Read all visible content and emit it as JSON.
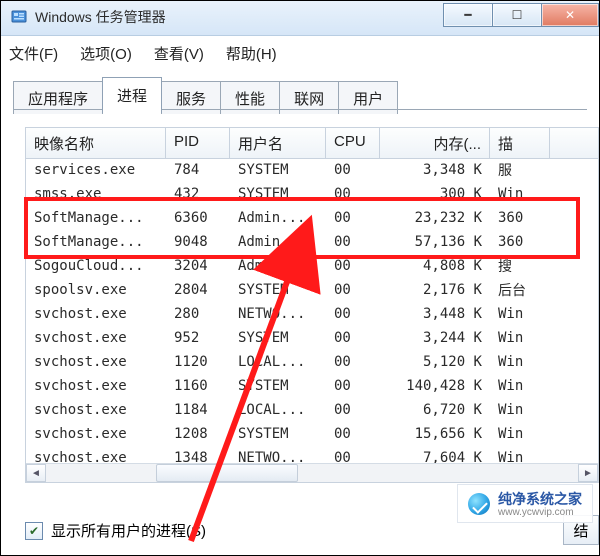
{
  "titlebar": {
    "title": "Windows 任务管理器"
  },
  "menu": {
    "file": "文件(F)",
    "options": "选项(O)",
    "view": "查看(V)",
    "help": "帮助(H)"
  },
  "tabs": {
    "apps": "应用程序",
    "processes": "进程",
    "services": "服务",
    "performance": "性能",
    "network": "联网",
    "users": "用户"
  },
  "columns": {
    "image": "映像名称",
    "pid": "PID",
    "user": "用户名",
    "cpu": "CPU",
    "mem": "内存(...",
    "desc": "描"
  },
  "rows": [
    {
      "n": "services.exe",
      "p": "784",
      "u": "SYSTEM",
      "c": "00",
      "m": "3,348 K",
      "d": "服"
    },
    {
      "n": "smss.exe",
      "p": "432",
      "u": "SYSTEM",
      "c": "00",
      "m": "300 K",
      "d": "Win"
    },
    {
      "n": "SoftManage...",
      "p": "6360",
      "u": "Admin...",
      "c": "00",
      "m": "23,232 K",
      "d": "360"
    },
    {
      "n": "SoftManage...",
      "p": "9048",
      "u": "Admin...",
      "c": "00",
      "m": "57,136 K",
      "d": "360"
    },
    {
      "n": "SogouCloud...",
      "p": "3204",
      "u": "Admin...",
      "c": "00",
      "m": "4,808 K",
      "d": "搜"
    },
    {
      "n": "spoolsv.exe",
      "p": "2804",
      "u": "SYSTEM",
      "c": "00",
      "m": "2,176 K",
      "d": "后台"
    },
    {
      "n": "svchost.exe",
      "p": "280",
      "u": "NETWO...",
      "c": "00",
      "m": "3,448 K",
      "d": "Win"
    },
    {
      "n": "svchost.exe",
      "p": "952",
      "u": "SYSTEM",
      "c": "00",
      "m": "3,244 K",
      "d": "Win"
    },
    {
      "n": "svchost.exe",
      "p": "1120",
      "u": "LOCAL...",
      "c": "00",
      "m": "5,120 K",
      "d": "Win"
    },
    {
      "n": "svchost.exe",
      "p": "1160",
      "u": "SYSTEM",
      "c": "00",
      "m": "140,428 K",
      "d": "Win"
    },
    {
      "n": "svchost.exe",
      "p": "1184",
      "u": "LOCAL...",
      "c": "00",
      "m": "6,720 K",
      "d": "Win"
    },
    {
      "n": "svchost.exe",
      "p": "1208",
      "u": "SYSTEM",
      "c": "00",
      "m": "15,656 K",
      "d": "Win"
    },
    {
      "n": "svchost.exe",
      "p": "1348",
      "u": "NETWO...",
      "c": "00",
      "m": "7,604 K",
      "d": "Win"
    }
  ],
  "footer": {
    "show_all": "显示所有用户的进程(S)",
    "end_btn": "结"
  },
  "watermark": {
    "name": "纯净系统之家",
    "url": "www.ycwvip.com"
  }
}
